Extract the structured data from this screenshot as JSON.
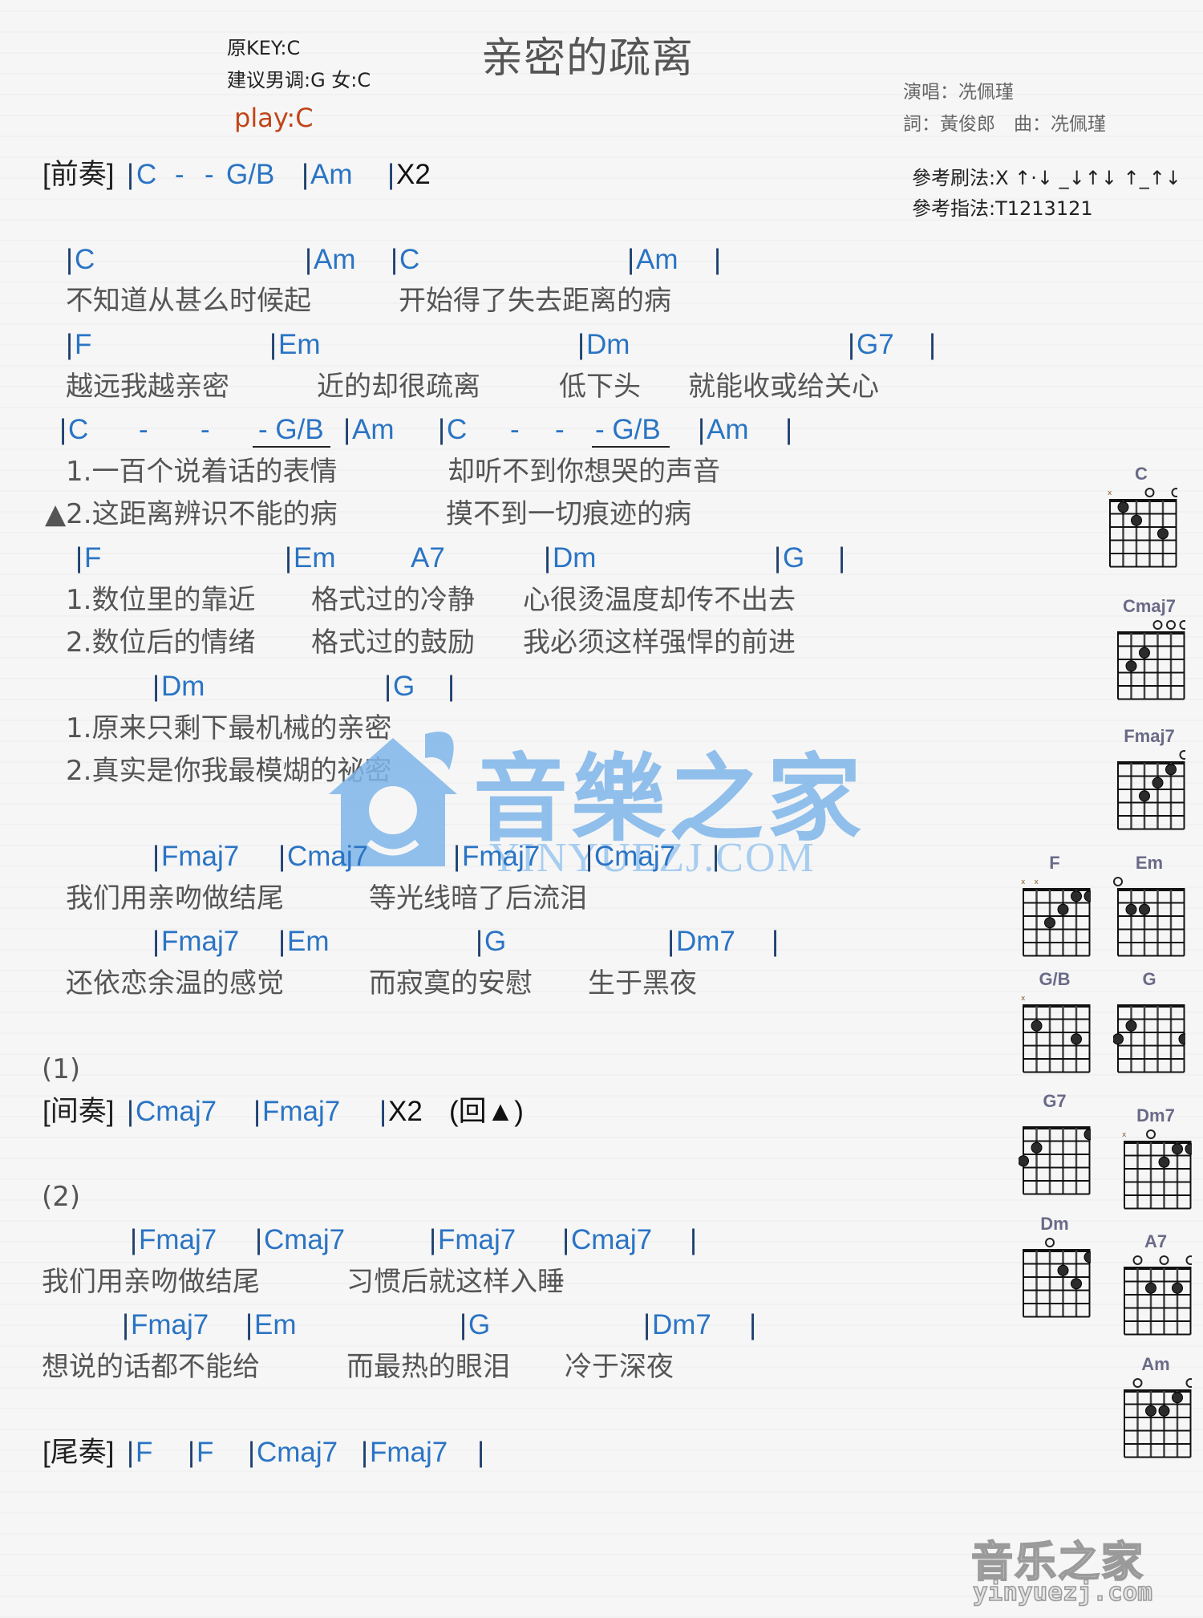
{
  "header": {
    "title": "亲密的疏离",
    "original_key": "原KEY:C",
    "suggested_key": "建议男调:G 女:C",
    "play_key": "play:C",
    "singer": "演唱：冼佩瑾",
    "credits": "詞：黃俊郎　曲：冼佩瑾",
    "strum_pattern": "參考刷法:X ↑·↓ _↓↑↓ ↑_↑↓",
    "fingerpick_pattern": "參考指法:T1213121"
  },
  "intro": {
    "label": "[前奏]",
    "tokens": [
      "|",
      "C",
      "-",
      "-",
      "G/B",
      "|",
      "Am",
      "|",
      "X2"
    ]
  },
  "verse1": {
    "chords1": [
      "C",
      "Am",
      "C",
      "Am"
    ],
    "lyric1": [
      "不知道从甚么时候起",
      "开始得了失去距离的病"
    ],
    "chords2": [
      "F",
      "Em",
      "Dm",
      "G7"
    ],
    "lyric2": [
      "越远我越亲密",
      "近的却很疏离",
      "低下头",
      "就能收或给关心"
    ],
    "chords3": [
      "C",
      "-",
      "-",
      "- G/B",
      "Am",
      "C",
      "-",
      "-",
      "- G/B",
      "Am"
    ],
    "lyric3a": [
      "1.一百个说着话的表情",
      "却听不到你想哭的声音"
    ],
    "lyric3b": [
      "▲2.这距离辨识不能的病",
      "摸不到一切痕迹的病"
    ],
    "chords4": [
      "F",
      "Em",
      "A7",
      "Dm",
      "G"
    ],
    "lyric4a": [
      "1.数位里的靠近",
      "格式过的冷静",
      "心很烫温度却传不出去"
    ],
    "lyric4b": [
      "2.数位后的情绪",
      "格式过的鼓励",
      "我必须这样强悍的前进"
    ],
    "chords5": [
      "Dm",
      "G"
    ],
    "lyric5a": "1.原来只剩下最机械的亲密",
    "lyric5b": "2.真实是你我最模煳的祕密"
  },
  "chorus1": {
    "chords1": [
      "Fmaj7",
      "Cmaj7",
      "Fmaj7",
      "Cmaj7"
    ],
    "lyric1": [
      "我们用亲吻做结尾",
      "等光线暗了后流泪"
    ],
    "chords2": [
      "Fmaj7",
      "Em",
      "G",
      "Dm7"
    ],
    "lyric2": [
      "还依恋余温的感觉",
      "而寂寞的安慰",
      "生于黑夜"
    ]
  },
  "interlude": {
    "marker": "(1)",
    "label": "[间奏]",
    "chords": [
      "Cmaj7",
      "Fmaj7"
    ],
    "repeat": "X2",
    "return": "(回▲)"
  },
  "chorus2": {
    "marker": "(2)",
    "chords1": [
      "Fmaj7",
      "Cmaj7",
      "Fmaj7",
      "Cmaj7"
    ],
    "lyric1": [
      "我们用亲吻做结尾",
      "习惯后就这样入睡"
    ],
    "chords2": [
      "Fmaj7",
      "Em",
      "G",
      "Dm7"
    ],
    "lyric2": [
      "想说的话都不能给",
      "而最热的眼泪",
      "冷于深夜"
    ]
  },
  "outro": {
    "label": "[尾奏]",
    "chords": [
      "F",
      "F",
      "Cmaj7",
      "Fmaj7"
    ]
  },
  "chord_diagrams": [
    {
      "name": "C",
      "top": [
        "x",
        "",
        "",
        "o",
        "",
        "o"
      ],
      "dots": [
        [
          5,
          1
        ],
        [
          4,
          2
        ],
        [
          2,
          3
        ]
      ]
    },
    {
      "name": "Cmaj7",
      "top": [
        "",
        "",
        "",
        "o",
        "o",
        "o"
      ],
      "dots": [
        [
          4,
          2
        ],
        [
          5,
          3
        ]
      ]
    },
    {
      "name": "Fmaj7",
      "top": [
        "",
        "",
        "",
        "",
        "",
        "o"
      ],
      "dots": [
        [
          2,
          1
        ],
        [
          3,
          2
        ],
        [
          4,
          3
        ]
      ]
    },
    {
      "name": "F",
      "top": [
        "x",
        "x",
        "",
        "",
        "",
        ""
      ],
      "dots": [
        [
          2,
          1
        ],
        [
          1,
          1
        ],
        [
          3,
          2
        ],
        [
          4,
          3
        ]
      ]
    },
    {
      "name": "Em",
      "top": [
        "o",
        "",
        "",
        "",
        "",
        ""
      ],
      "dots": [
        [
          5,
          2
        ],
        [
          4,
          2
        ]
      ]
    },
    {
      "name": "G/B",
      "top": [
        "x",
        "",
        "",
        "",
        "",
        ""
      ],
      "dots": [
        [
          5,
          2
        ],
        [
          2,
          3
        ]
      ]
    },
    {
      "name": "G",
      "top": [
        "",
        "",
        "",
        "",
        "",
        ""
      ],
      "dots": [
        [
          5,
          2
        ],
        [
          6,
          3
        ],
        [
          1,
          3
        ]
      ]
    },
    {
      "name": "G7",
      "top": [
        "",
        "",
        "",
        "",
        "",
        ""
      ],
      "dots": [
        [
          1,
          1
        ],
        [
          5,
          2
        ],
        [
          6,
          3
        ]
      ]
    },
    {
      "name": "Dm7",
      "top": [
        "x",
        "",
        "o",
        "",
        "",
        ""
      ],
      "dots": [
        [
          2,
          1
        ],
        [
          1,
          1
        ],
        [
          3,
          2
        ]
      ]
    },
    {
      "name": "Dm",
      "top": [
        "",
        "",
        "o",
        "",
        "",
        ""
      ],
      "dots": [
        [
          1,
          1
        ],
        [
          3,
          2
        ],
        [
          2,
          3
        ]
      ]
    },
    {
      "name": "A7",
      "top": [
        "",
        "o",
        "",
        "o",
        "",
        "o"
      ],
      "dots": [
        [
          4,
          2
        ],
        [
          2,
          2
        ]
      ]
    },
    {
      "name": "Am",
      "top": [
        "",
        "o",
        "",
        "",
        "",
        "o"
      ],
      "dots": [
        [
          2,
          1
        ],
        [
          4,
          2
        ],
        [
          3,
          2
        ]
      ]
    }
  ],
  "watermark": {
    "logo_text": "音樂之家",
    "url": "YINYUEZJ.COM"
  },
  "footer_logo": {
    "text": "音乐之家",
    "url": "yinyuezj.com"
  },
  "colors": {
    "chord": "#2a74c4",
    "lyric": "#555555",
    "play": "#c0451a",
    "watermark": "#7fb6ea"
  }
}
